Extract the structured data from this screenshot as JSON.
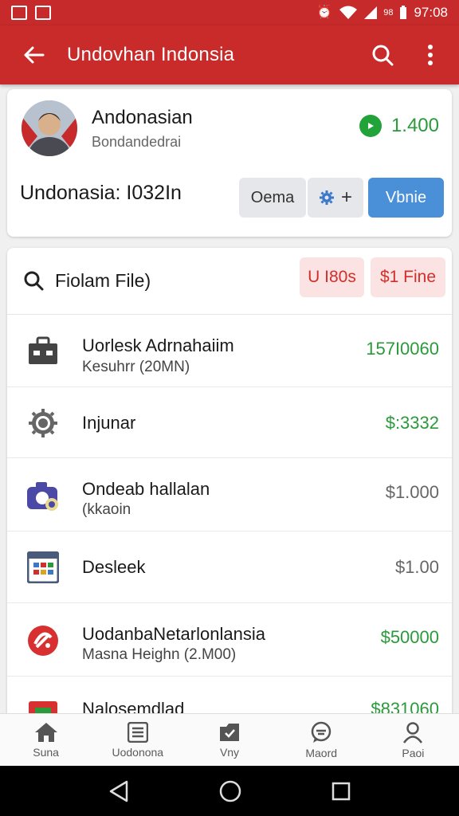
{
  "status_bar": {
    "time": "97:08",
    "network_label": "98",
    "left_icons": [
      "image-icon",
      "alert-triangle-icon"
    ],
    "right_icons": [
      "alarm-icon",
      "wifi-icon",
      "signal-icon",
      "battery-icon"
    ]
  },
  "app_bar": {
    "title": "Undovhan Indonsia",
    "icons": [
      "back-arrow-icon",
      "search-icon",
      "more-vert-icon"
    ]
  },
  "profile": {
    "name": "Andonasian",
    "subtitle": "Bondandedrai",
    "balance": "1.400",
    "id_label": "Undonasia: I032In",
    "buttons": {
      "grey_label": "Oema",
      "settings_add_symbol": "+",
      "blue_label": "Vbnie"
    }
  },
  "file_section": {
    "title": "Fiolam File)",
    "chips": [
      "U I80s",
      "$1 Fine"
    ],
    "items": [
      {
        "title": "Uorlesk Adrnahaiim",
        "subtitle": "Kesuhrr (20MN)",
        "value": "157I0060",
        "value_color": "green",
        "icon": "briefcase-icon"
      },
      {
        "title": "Injunar",
        "subtitle": "",
        "value": "$:3332",
        "value_color": "green",
        "icon": "gear-icon"
      },
      {
        "title": "Ondeab hallalan",
        "subtitle": "(kkaoin",
        "value": "$1.000",
        "value_color": "grey",
        "icon": "camera-icon"
      },
      {
        "title": "Desleek",
        "subtitle": "",
        "value": "$1.00",
        "value_color": "grey",
        "icon": "calendar-grid-icon"
      },
      {
        "title": "UodanbaNetarlonlansia",
        "subtitle": "Masna Heighn (2.M00)",
        "value": "$50000",
        "value_color": "green",
        "icon": "red-target-icon"
      },
      {
        "title": "Nalosemdlad",
        "subtitle": "",
        "value": "$831060",
        "value_color": "green",
        "icon": "red-box-icon"
      }
    ]
  },
  "bottom_nav": [
    {
      "label": "Suna",
      "icon": "home-icon"
    },
    {
      "label": "Uodonona",
      "icon": "list-icon"
    },
    {
      "label": "Vny",
      "icon": "tag-icon"
    },
    {
      "label": "Maord",
      "icon": "chat-icon"
    },
    {
      "label": "Paoi",
      "icon": "person-icon"
    }
  ],
  "colors": {
    "app_bar": "#c92b2b",
    "accent_green": "#2a9a3a",
    "button_blue": "#4a90d9",
    "chip_bg": "#fbe3e3",
    "chip_text": "#d0302a"
  }
}
